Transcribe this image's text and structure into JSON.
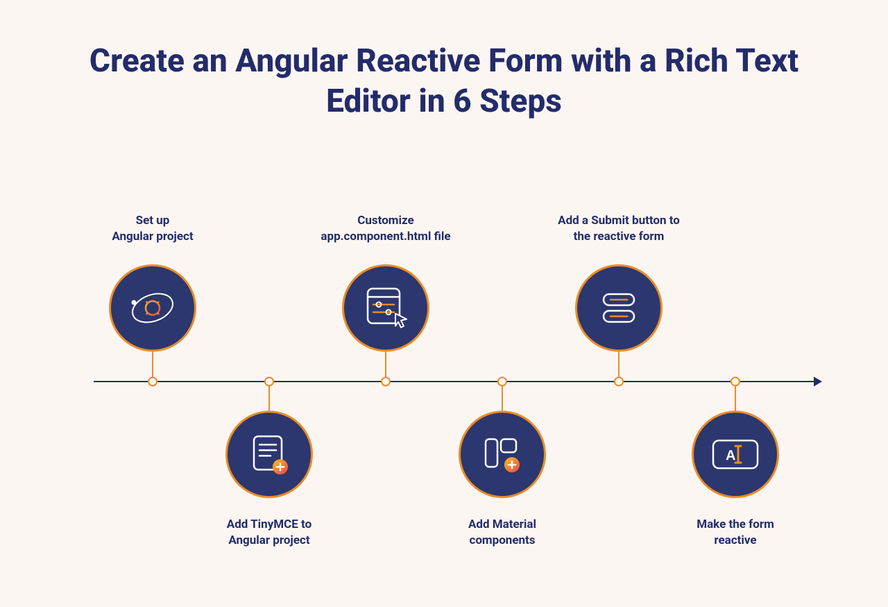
{
  "title": "Create an Angular Reactive Form with a Rich Text Editor in 6 Steps",
  "steps": [
    {
      "label": "Set up\nAngular project"
    },
    {
      "label": "Add TinyMCE to\nAngular project"
    },
    {
      "label": "Customize\napp.component.html file"
    },
    {
      "label": "Add Material\ncomponents"
    },
    {
      "label": "Add a Submit button to\nthe reactive form"
    },
    {
      "label": "Make the form\nreactive"
    }
  ],
  "colors": {
    "bg": "#fcf6f3",
    "primary": "#2b376e",
    "accent": "#eb8c26",
    "title": "#232c6a"
  }
}
